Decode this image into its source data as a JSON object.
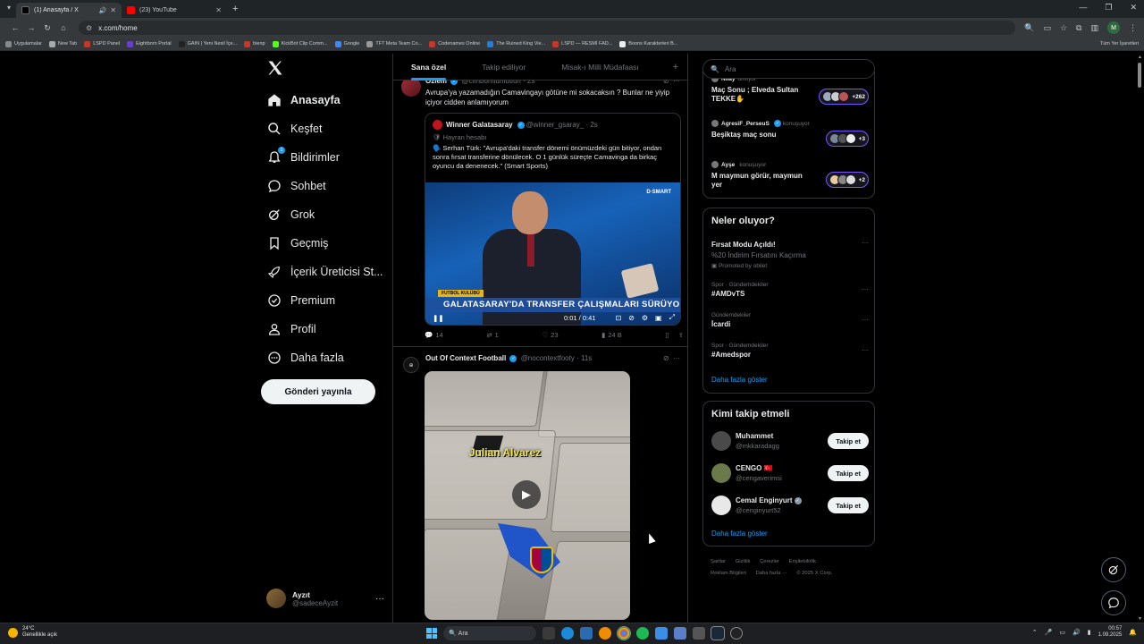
{
  "browser": {
    "tabs": [
      {
        "label": "(1) Anasayfa / X",
        "active": true,
        "favicon": "x-favicon"
      },
      {
        "label": "(23) YouTube",
        "active": false,
        "favicon": "youtube-favicon"
      }
    ],
    "url": "x.com/home",
    "profile_initial": "M",
    "bookmarks": [
      {
        "label": "Uygulamalar",
        "color": "#888"
      },
      {
        "label": "New Tab",
        "color": "#aaa"
      },
      {
        "label": "LSPD Panel",
        "color": "#c0392b"
      },
      {
        "label": "Eightborn Portal",
        "color": "#6a3fc7"
      },
      {
        "label": "GAIN | Yeni Nesil İçe...",
        "color": "#222"
      },
      {
        "label": "bienp",
        "color": "#c0392b"
      },
      {
        "label": "KickBot Clip Comm...",
        "color": "#53fc18"
      },
      {
        "label": "Google",
        "color": "#4285f4"
      },
      {
        "label": "TFT Meta Team Co...",
        "color": "#999"
      },
      {
        "label": "Codenames Online",
        "color": "#c0392b"
      },
      {
        "label": "The Ruined King Vie...",
        "color": "#2a7bd6"
      },
      {
        "label": "LSPD — RESMİ FAD...",
        "color": "#c0392b"
      },
      {
        "label": "Boons Karakterleri B...",
        "color": "#eee"
      }
    ],
    "all_bookmarks": "Tüm Yer İşaretleri"
  },
  "sidebar": {
    "nav": [
      {
        "label": "Anasayfa",
        "icon": "home-icon",
        "active": true
      },
      {
        "label": "Keşfet",
        "icon": "search-icon"
      },
      {
        "label": "Bildirimler",
        "icon": "bell-icon",
        "badge": "1"
      },
      {
        "label": "Sohbet",
        "icon": "chat-icon"
      },
      {
        "label": "Grok",
        "icon": "grok-icon"
      },
      {
        "label": "Geçmiş",
        "icon": "bookmark-icon"
      },
      {
        "label": "İçerik Üreticisi St...",
        "icon": "rocket-icon"
      },
      {
        "label": "Premium",
        "icon": "verified-icon"
      },
      {
        "label": "Profil",
        "icon": "person-icon"
      },
      {
        "label": "Daha fazla",
        "icon": "more-circle-icon"
      }
    ],
    "post_button": "Gönderi yayınla",
    "account": {
      "name": "Ayzıt",
      "handle": "@sadeceAyzit"
    }
  },
  "timeline": {
    "tabs": [
      "Sana özel",
      "Takip ediliyor",
      "Misak-ı Milli Müdafaası"
    ],
    "tweet1": {
      "name": "Özlem",
      "handle": "@cimbomlumutluh",
      "time": "2s",
      "text": "Avrupa'ya yazamadığın Camavingayı götüne mi sokacaksın ? Bunlar ne yiyip içiyor cidden anlamıyorum",
      "quote": {
        "name": "Winner Galatasaray",
        "handle": "@winner_gsaray_",
        "time": "2s",
        "sub": "Hayran hesabı",
        "text": "🗣️ Serhan Türk: \"Avrupa'daki transfer dönemi önümüzdeki gün bitiyor, ondan sonra fırsat transferine dönülecek. O 1 günlük süreçte Camavinga da birkaç oyuncu da denenecek.\" (Smart Sports)",
        "video": {
          "channel": "D·SMART",
          "tag": "FUTBOL KULÜBÜ",
          "banner": "GALATASARAY'DA TRANSFER ÇALIŞMALARI SÜRÜYOR",
          "time": "0:01 / 0:41"
        }
      },
      "actions": {
        "replies": "14",
        "reposts": "1",
        "likes": "23",
        "views": "24 B"
      }
    },
    "tweet2": {
      "name": "Out Of Context Football",
      "handle": "@nocontextfooty",
      "time": "11s",
      "caption": "Julian Alvarez"
    }
  },
  "right": {
    "search_placeholder": "Ara",
    "live": [
      {
        "host": "Nilay",
        "status": "dinliyor",
        "title": "Maç Sonu ; Elveda Sultan TEKKE✋",
        "count": "+262"
      },
      {
        "host": "AgresiF_PerseuS",
        "status": "konuşuyor",
        "title": "Beşiktaş maç sonu",
        "count": "+3"
      },
      {
        "host": "Ayşe",
        "status": "konuşuyor",
        "title": "M maymun görür, maymun yer",
        "count": "+2"
      }
    ],
    "happening_title": "Neler oluyor?",
    "trends": [
      {
        "meta": "",
        "name": "Fırsat Modu Açıldı!",
        "sub": "%20 İndirim Fırsatını Kaçırma",
        "promo": "Promoted by obilet"
      },
      {
        "meta": "Spor · Gündemdekiler",
        "name": "#AMDvTS"
      },
      {
        "meta": "Gündemdekiler",
        "name": "İcardi"
      },
      {
        "meta": "Spor · Gündemdekiler",
        "name": "#Amedspor"
      }
    ],
    "show_more": "Daha fazla göster",
    "follow_title": "Kimi takip etmeli",
    "follow": [
      {
        "name": "Muhammet",
        "handle": "@mkkaradagg",
        "button": "Takip et",
        "avatar": "#555"
      },
      {
        "name": "CENGO 🇹🇷",
        "handle": "@cengaverimsi",
        "button": "Takip et",
        "avatar": "#6b7a4a"
      },
      {
        "name": "Cemal Enginyurt",
        "handle": "@cenginyurt52",
        "button": "Takip et",
        "avatar": "#ddd"
      }
    ],
    "footer": [
      "Şartlar",
      "Gizlilik",
      "Çerezler",
      "Erişilebilirlik",
      "Reklam Bilgileri",
      "Daha fazla ···",
      "© 2025 X Corp."
    ]
  },
  "taskbar": {
    "weather_temp": "24°C",
    "weather_desc": "Genellikle açık",
    "search": "Ara",
    "time": "00:57",
    "date": "1.09.2025"
  },
  "colors": {
    "accent": "#1d9bf0",
    "background": "#000000",
    "border": "#2f3336",
    "muted": "#71767b"
  }
}
